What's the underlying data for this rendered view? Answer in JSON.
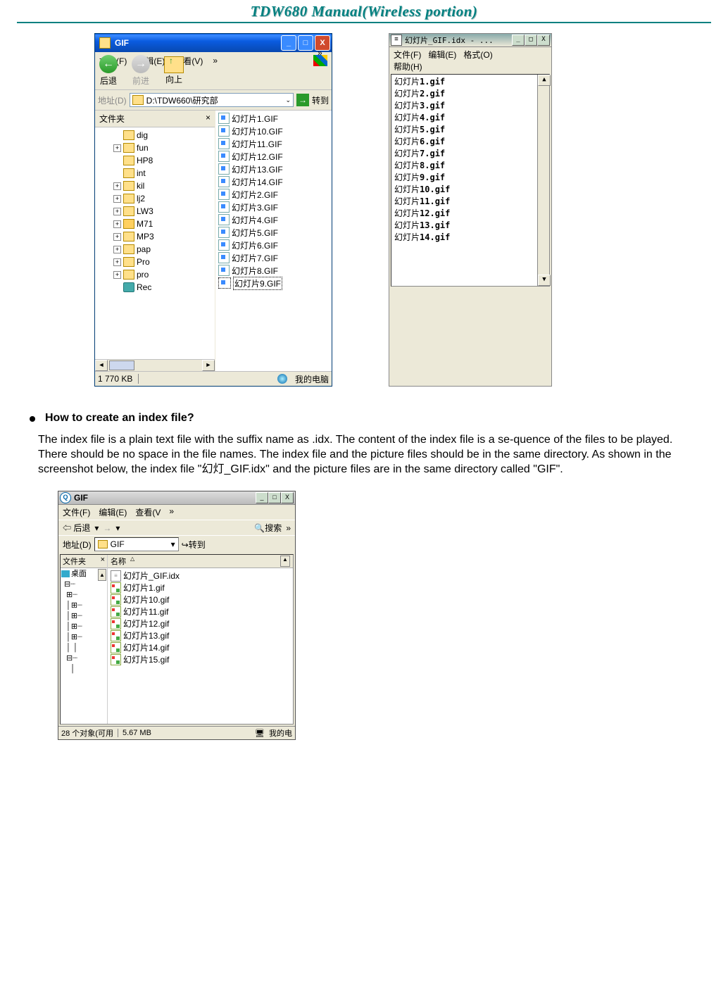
{
  "doc": {
    "title": "TDW680 Manual(Wireless portion)"
  },
  "win1": {
    "title": "GIF",
    "menu": {
      "file": "文件(F)",
      "edit": "编辑(E)",
      "view": "查看(V)",
      "more": "»"
    },
    "tool": {
      "back": "后退",
      "forward": "前进",
      "up": "向上"
    },
    "addr": {
      "label": "地址(D)",
      "path": "D:\\TDW660\\研究部",
      "go": "转到"
    },
    "treeTitle": "文件夹",
    "tree": [
      {
        "p": 0,
        "t": "dig",
        "ico": "f"
      },
      {
        "p": 1,
        "t": "fun",
        "ico": "f"
      },
      {
        "p": 0,
        "t": "HP8",
        "ico": "f"
      },
      {
        "p": 0,
        "t": "int",
        "ico": "f"
      },
      {
        "p": 1,
        "t": "kil",
        "ico": "f"
      },
      {
        "p": 1,
        "t": "lj2",
        "ico": "f"
      },
      {
        "p": 1,
        "t": "LW3",
        "ico": "f"
      },
      {
        "p": 1,
        "t": "M71",
        "ico": "fo"
      },
      {
        "p": 1,
        "t": "MP3",
        "ico": "f"
      },
      {
        "p": 1,
        "t": "pap",
        "ico": "f"
      },
      {
        "p": 1,
        "t": "Pro",
        "ico": "f"
      },
      {
        "p": 1,
        "t": "pro",
        "ico": "f"
      },
      {
        "p": 0,
        "t": "Rec",
        "ico": "r"
      }
    ],
    "files": [
      "幻灯片1.GIF",
      "幻灯片10.GIF",
      "幻灯片11.GIF",
      "幻灯片12.GIF",
      "幻灯片13.GIF",
      "幻灯片14.GIF",
      "幻灯片2.GIF",
      "幻灯片3.GIF",
      "幻灯片4.GIF",
      "幻灯片5.GIF",
      "幻灯片6.GIF",
      "幻灯片7.GIF",
      "幻灯片8.GIF",
      "幻灯片9.GIF"
    ],
    "status": {
      "left": "1 770 KB",
      "right": "我的电脑"
    }
  },
  "notepad": {
    "title": "幻灯片_GIF.idx - ...",
    "menu": {
      "file": "文件(F)",
      "edit": "编辑(E)",
      "format": "格式(O)",
      "help": "帮助(H)"
    },
    "lines": [
      "幻灯片1.gif",
      "幻灯片2.gif",
      "幻灯片3.gif",
      "幻灯片4.gif",
      "幻灯片5.gif",
      "幻灯片6.gif",
      "幻灯片7.gif",
      "幻灯片8.gif",
      "幻灯片9.gif",
      "幻灯片10.gif",
      "幻灯片11.gif",
      "幻灯片12.gif",
      "幻灯片13.gif",
      "幻灯片14.gif"
    ]
  },
  "section": {
    "heading": "How to create an index file?",
    "body": "The index file is a plain text file with the suffix name as .idx. The content of the index file is a se-quence of the files to be played. There should be no space in the file names. The index file and the picture files should be in the same directory. As shown in the screenshot below, the index file \"幻灯_GIF.idx\" and the picture files are in the same directory called \"GIF\"."
  },
  "win2": {
    "title": "GIF",
    "menu": {
      "file": "文件(F)",
      "edit": "编辑(E)",
      "view": "查看(V",
      "more": "»"
    },
    "tool": {
      "back": "后退",
      "search": "搜索",
      "more": "»"
    },
    "addr": {
      "label": "地址(D)",
      "value": "GIF",
      "go": "转到"
    },
    "treeTitle": "文件夹",
    "treeItems": [
      "桌面"
    ],
    "colhead": "名称",
    "files": [
      {
        "t": "幻灯片_GIF.idx",
        "ico": "idx"
      },
      {
        "t": "幻灯片1.gif",
        "ico": "gif"
      },
      {
        "t": "幻灯片10.gif",
        "ico": "gif"
      },
      {
        "t": "幻灯片11.gif",
        "ico": "gif"
      },
      {
        "t": "幻灯片12.gif",
        "ico": "gif"
      },
      {
        "t": "幻灯片13.gif",
        "ico": "gif"
      },
      {
        "t": "幻灯片14.gif",
        "ico": "gif"
      },
      {
        "t": "幻灯片15.gif",
        "ico": "gif"
      }
    ],
    "status": {
      "left": "28 个对象(可用",
      "mid": "5.67 MB",
      "right": "我的电"
    }
  }
}
